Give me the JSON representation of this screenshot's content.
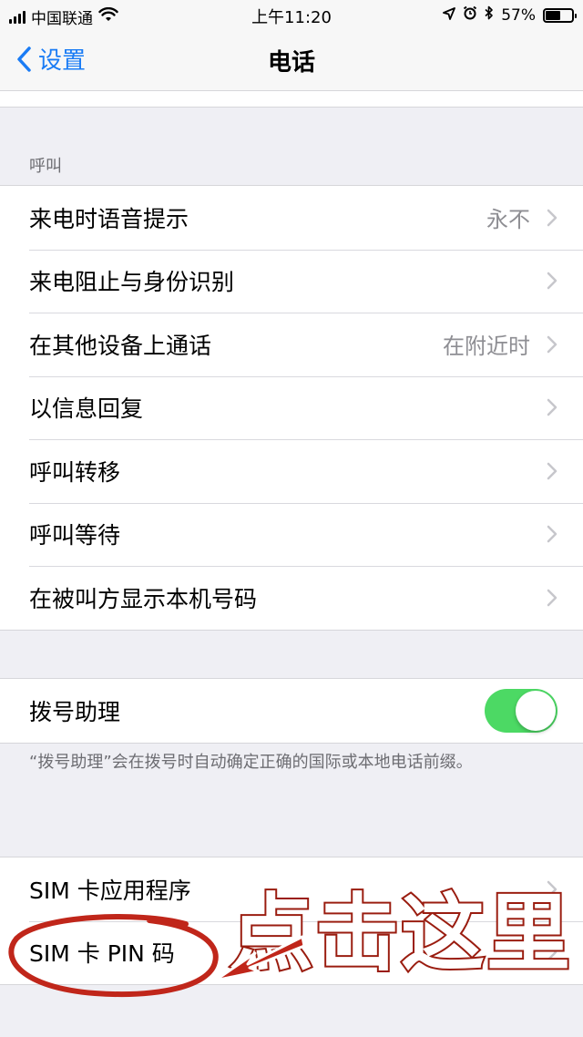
{
  "status_bar": {
    "carrier": "中国联通",
    "time": "上午11:20",
    "battery": "57%",
    "battery_level": 0.57,
    "icons": [
      "signal-icon",
      "wifi-icon",
      "location-icon",
      "alarm-icon",
      "bluetooth-icon",
      "battery-icon"
    ]
  },
  "nav": {
    "back_label": "设置",
    "title": "电话"
  },
  "calls_section": {
    "header": "呼叫",
    "items": [
      {
        "label": "来电时语音提示",
        "value": "永不"
      },
      {
        "label": "来电阻止与身份识别",
        "value": ""
      },
      {
        "label": "在其他设备上通话",
        "value": "在附近时"
      },
      {
        "label": "以信息回复",
        "value": ""
      },
      {
        "label": "呼叫转移",
        "value": ""
      },
      {
        "label": "呼叫等待",
        "value": ""
      },
      {
        "label": "在被叫方显示本机号码",
        "value": ""
      }
    ]
  },
  "dial_assist": {
    "label": "拨号助理",
    "enabled": true,
    "footer": "“拨号助理”会在拨号时自动确定正确的国际或本地电话前缀。"
  },
  "sim_section": {
    "items": [
      {
        "label": "SIM 卡应用程序"
      },
      {
        "label": "SIM 卡 PIN 码"
      }
    ]
  },
  "annotation": {
    "text": "点击这里"
  },
  "colors": {
    "accent": "#1a7cf5",
    "toggle_on": "#4cd964",
    "annotation_red": "#c0261a"
  }
}
